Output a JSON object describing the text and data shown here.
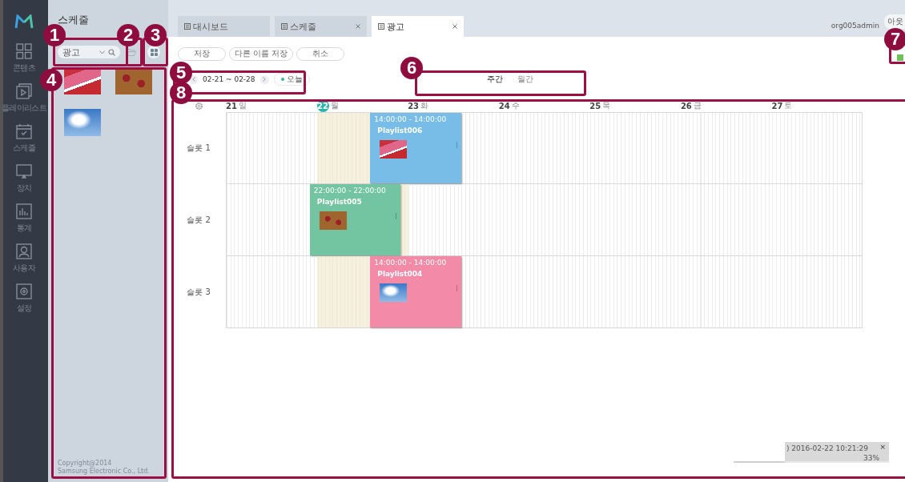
{
  "nav": {
    "items": [
      {
        "label": "콘텐츠",
        "selected": false
      },
      {
        "label": "플레이리스트",
        "selected": false
      },
      {
        "label": "스케줄",
        "selected": false
      },
      {
        "label": "장치",
        "selected": false
      },
      {
        "label": "통계",
        "selected": false
      },
      {
        "label": "사용자",
        "selected": false
      },
      {
        "label": "설정",
        "selected": false
      }
    ]
  },
  "panel": {
    "title": "스케줄",
    "search": {
      "value": "광고"
    },
    "thumbnails": [
      {
        "kind": "cake"
      },
      {
        "kind": "tart"
      },
      {
        "kind": "sky"
      }
    ],
    "copyright": [
      "Copyright@2014",
      "Samsung Electronic Co., Ltd."
    ]
  },
  "tabs": [
    {
      "label": "대시보드",
      "closable": false,
      "selected": false
    },
    {
      "label": "스케줄",
      "closable": true,
      "selected": false
    },
    {
      "label": "광고",
      "closable": true,
      "selected": true
    }
  ],
  "user": "org005admin",
  "logout": "아웃",
  "toolbar": {
    "buttons": [
      "저장",
      "다른 이름 저장",
      "취소"
    ]
  },
  "date_nav": {
    "range": "02-21 ~ 02-28",
    "today": "오늘"
  },
  "views": [
    {
      "label": "주간",
      "selected": true
    },
    {
      "label": "월간",
      "selected": false
    }
  ],
  "calendar": {
    "days": [
      {
        "num": "21",
        "weekday": "일",
        "today": false
      },
      {
        "num": "22",
        "weekday": "월",
        "today": true
      },
      {
        "num": "23",
        "weekday": "화",
        "today": false
      },
      {
        "num": "24",
        "weekday": "수",
        "today": false
      },
      {
        "num": "25",
        "weekday": "목",
        "today": false
      },
      {
        "num": "26",
        "weekday": "금",
        "today": false
      },
      {
        "num": "27",
        "weekday": "토",
        "today": false
      }
    ],
    "slots": [
      {
        "label": "슬롯 1",
        "events": [
          {
            "time": "14:00:00 - 14:00:00",
            "title": "Playlist006",
            "color": "#78bde8"
          }
        ]
      },
      {
        "label": "슬롯 2",
        "events": [
          {
            "time": "22:00:00 - 22:00:00",
            "title": "Playlist005",
            "color": "#72c5a0"
          }
        ]
      },
      {
        "label": "슬롯 3",
        "events": [
          {
            "time": "14:00:00 - 14:00:00",
            "title": "Playlist004",
            "color": "#f28aa8"
          }
        ]
      }
    ]
  },
  "toast": {
    "text": ") 2016-02-22 10:21:29",
    "percent": "33%",
    "close": "×",
    "level": 0.33
  },
  "callouts": [
    "1",
    "2",
    "3",
    "4",
    "5",
    "6",
    "7",
    "8"
  ]
}
